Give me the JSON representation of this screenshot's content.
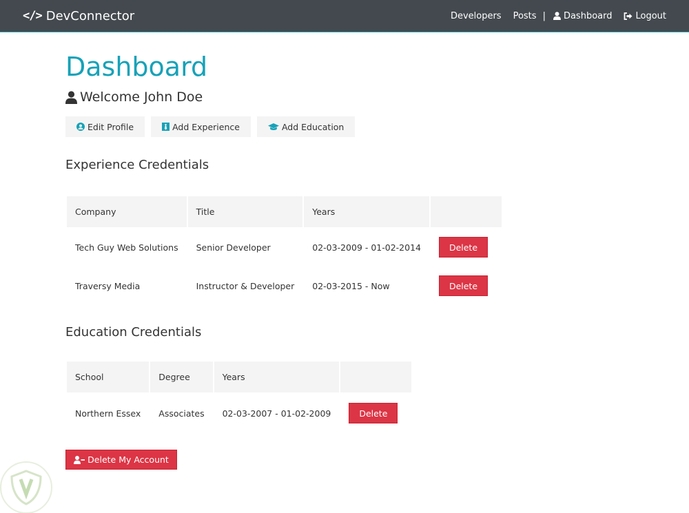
{
  "navbar": {
    "brand": "DevConnector",
    "brand_icon": "code-icon",
    "links": {
      "developers": "Developers",
      "posts": "Posts",
      "separator": "|",
      "dashboard": "Dashboard",
      "logout": "Logout"
    }
  },
  "page": {
    "title": "Dashboard",
    "welcome": "Welcome John Doe"
  },
  "actions": {
    "edit_profile": "Edit Profile",
    "add_experience": "Add Experience",
    "add_education": "Add Education"
  },
  "experience": {
    "title": "Experience Credentials",
    "headers": [
      "Company",
      "Title",
      "Years",
      ""
    ],
    "rows": [
      {
        "company": "Tech Guy Web Solutions",
        "title": "Senior Developer",
        "years": "02-03-2009 - 01-02-2014",
        "action": "Delete"
      },
      {
        "company": "Traversy Media",
        "title": "Instructor & Developer",
        "years": "02-03-2015 - Now",
        "action": "Delete"
      }
    ]
  },
  "education": {
    "title": "Education Credentials",
    "headers": [
      "School",
      "Degree",
      "Years",
      ""
    ],
    "rows": [
      {
        "school": "Northern Essex",
        "degree": "Associates",
        "years": "02-03-2007 - 01-02-2009",
        "action": "Delete"
      }
    ]
  },
  "delete_account": "Delete My Account",
  "colors": {
    "primary": "#17a2b8",
    "dark": "#343a40",
    "danger": "#dc3545",
    "light": "#f4f4f4"
  }
}
